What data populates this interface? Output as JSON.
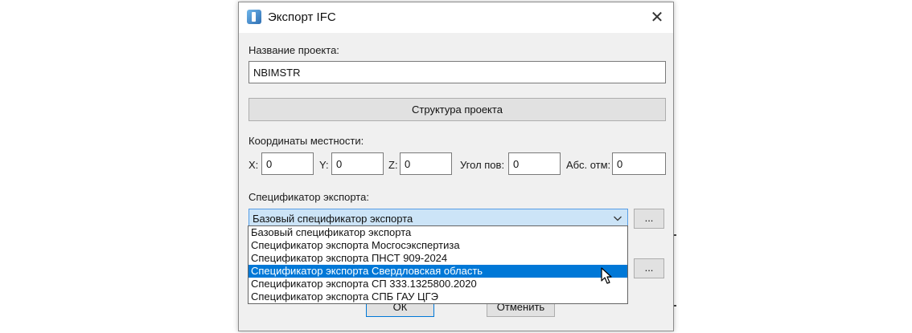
{
  "dialog": {
    "title": "Экспорт IFC",
    "close_glyph": "✕",
    "project_name_label": "Название проекта:",
    "project_name_value": "NBIMSTR",
    "project_structure_button": "Структура проекта",
    "coordinates_label": "Координаты местности:",
    "coords": {
      "x_label": "X:",
      "x_value": "0",
      "y_label": "Y:",
      "y_value": "0",
      "z_label": "Z:",
      "z_value": "0",
      "angle_label": "Угол пов:",
      "angle_value": "0",
      "abs_label": "Абс. отм:",
      "abs_value": "0"
    },
    "specifier_label": "Спецификатор экспорта:",
    "specifier_selected": "Базовый спецификатор экспорта",
    "browse_button": "...",
    "second_browse_button": "...",
    "ok_button": "ОК",
    "cancel_button": "Отменить",
    "dropdown_options": [
      "Базовый спецификатор экспорта",
      "Спецификатор экспорта Мосгосэкспертиза",
      "Спецификатор экспорта ПНСТ 909-2024",
      "Спецификатор экспорта Свердловская область",
      "Спецификатор экспорта СП 333.1325800.2020",
      "Спецификатор экспорта СПБ ГАУ ЦГЭ"
    ],
    "highlighted_option_index": 3
  },
  "icons": {
    "app": "ifc-export-app-icon",
    "close": "close-icon",
    "dropdown": "chevron-down-icon",
    "pointer": "mouse-pointer-icon"
  },
  "colors": {
    "selection": "#0078d7",
    "combo_focus_bg": "#cce4f7",
    "combo_focus_border": "#569de5",
    "dialog_bg": "#f0f0f0"
  }
}
